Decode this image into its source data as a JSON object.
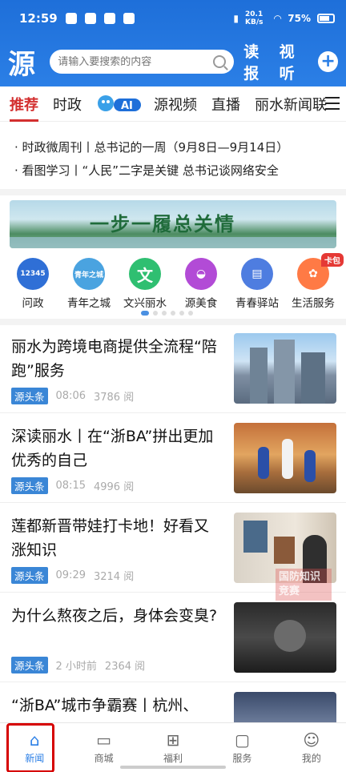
{
  "status": {
    "time": "12:59",
    "speed": "20.1 KB/s",
    "battery": "75%"
  },
  "header": {
    "logo": "源",
    "search_placeholder": "请输入要搜索的内容",
    "read_news": "读报",
    "watch": "视听"
  },
  "tabs": [
    "推荐",
    "时政",
    "源视频",
    "直播",
    "丽水新闻联"
  ],
  "ai_label": "AI",
  "ticker": [
    "· 时政微周刊丨总书记的一周（9月8日—9月14日）",
    "· 看图学习丨“人民”二字是关键 总书记谈网络安全"
  ],
  "banner": {
    "text": "一步一履总关情"
  },
  "quick_icons": [
    {
      "label": "问政",
      "badge": "12345",
      "color": "#2f6fd6"
    },
    {
      "label": "青年之城",
      "badge": "青年之城",
      "color": "#4aa3e0"
    },
    {
      "label": "文兴丽水",
      "badge": "文",
      "color": "#2fbf71"
    },
    {
      "label": "源美食",
      "badge": "",
      "color": "#b24bd6"
    },
    {
      "label": "青春驿站",
      "badge": "",
      "color": "#4e7de0"
    },
    {
      "label": "生活服务",
      "badge": "",
      "color": "#ff7a45",
      "ribbon": "卡包"
    }
  ],
  "articles": [
    {
      "title": "丽水为跨境电商提供全流程“陪跑”服务",
      "tag": "源头条",
      "time": "08:06",
      "reads": "3786 阅"
    },
    {
      "title": "深读丽水丨在“浙BA”拼出更加优秀的自己",
      "tag": "源头条",
      "time": "08:15",
      "reads": "4996 阅"
    },
    {
      "title": "莲都新晋带娃打卡地！好看又涨知识",
      "tag": "源头条",
      "time": "09:29",
      "reads": "3214 阅"
    },
    {
      "title": "为什么熬夜之后，身体会变臭?",
      "tag": "源头条",
      "time": "2 小时前",
      "reads": "2364 阅"
    },
    {
      "title": "“浙BA”城市争霸赛丨杭州、",
      "tag": "",
      "time": "",
      "reads": ""
    }
  ],
  "watermark": "国防知识竞赛",
  "bottom_nav": [
    {
      "label": "新闻",
      "icon": "home-icon"
    },
    {
      "label": "商城",
      "icon": "store-icon"
    },
    {
      "label": "福利",
      "icon": "gift-icon"
    },
    {
      "label": "服务",
      "icon": "bag-icon"
    },
    {
      "label": "我的",
      "icon": "user-icon"
    }
  ]
}
